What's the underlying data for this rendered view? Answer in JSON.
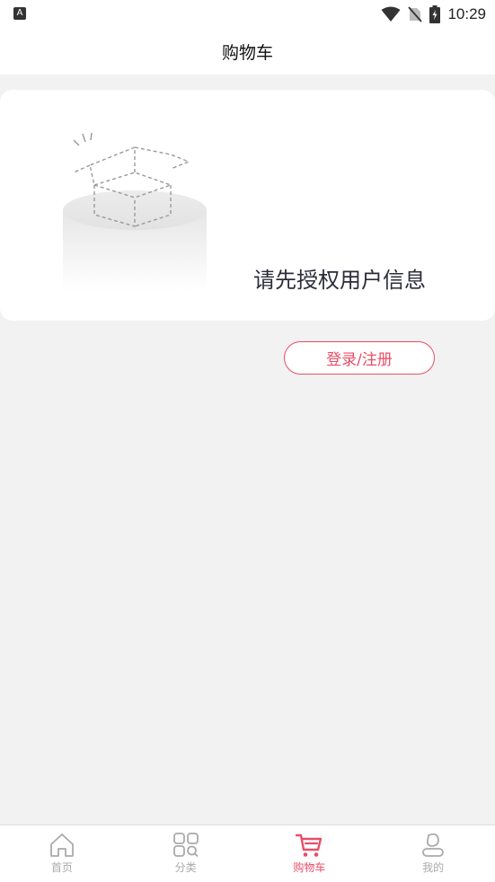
{
  "status_bar": {
    "left_icon": "A",
    "time": "10:29",
    "icons": [
      "wifi-icon",
      "no-sim-icon",
      "battery-charging-icon"
    ]
  },
  "header": {
    "title": "购物车"
  },
  "empty_state": {
    "illustration": "empty-box-illustration",
    "message": "请先授权用户信息",
    "button_label": "登录/注册"
  },
  "tabbar": {
    "items": [
      {
        "label": "首页",
        "icon": "home-icon",
        "active": false
      },
      {
        "label": "分类",
        "icon": "category-icon",
        "active": false
      },
      {
        "label": "购物车",
        "icon": "cart-icon",
        "active": true
      },
      {
        "label": "我的",
        "icon": "profile-icon",
        "active": false
      }
    ]
  },
  "colors": {
    "accent": "#e94e67",
    "background": "#f2f2f2",
    "inactive": "#aaaaaa"
  }
}
